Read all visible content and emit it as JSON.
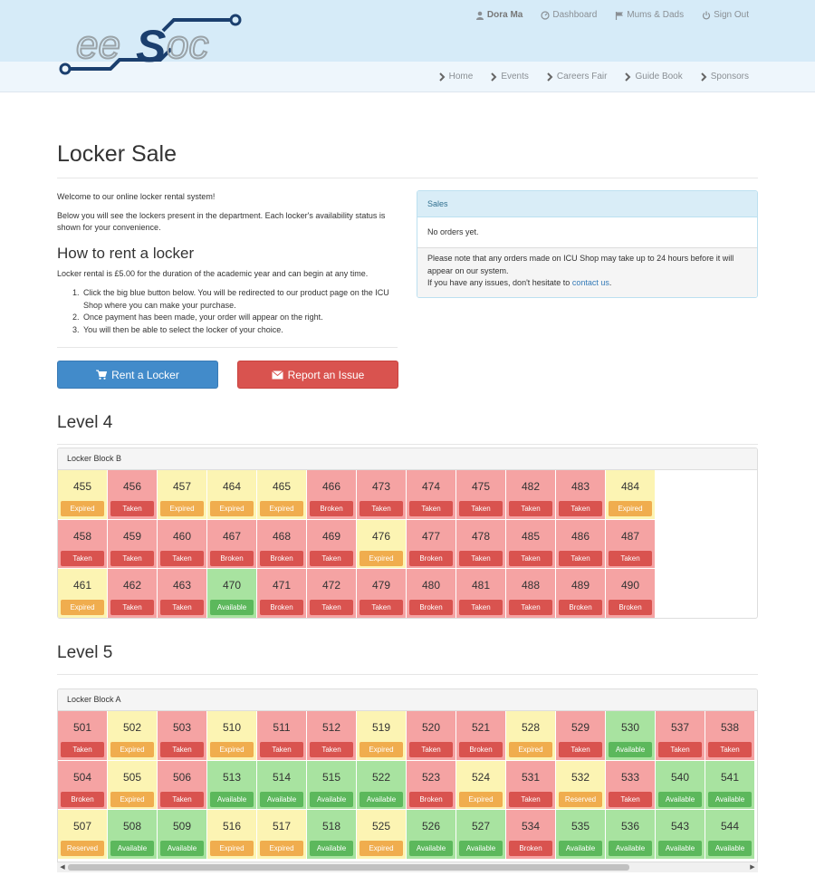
{
  "header": {
    "user": "Dora Ma",
    "top_links": [
      "Dashboard",
      "Mums & Dads",
      "Sign Out"
    ],
    "main_nav": [
      "Home",
      "Events",
      "Careers Fair",
      "Guide Book",
      "Sponsors"
    ]
  },
  "page": {
    "title": "Locker Sale",
    "welcome": "Welcome to our online locker rental system!",
    "intro": "Below you will see the lockers present in the department. Each locker's availability status is shown for your convenience.",
    "howto_title": "How to rent a locker",
    "price_text": "Locker rental is £5.00 for the duration of the academic year and can begin at any time.",
    "steps": [
      "Click the big blue button below. You will be redirected to our product page on the ICU Shop where you can make your purchase.",
      "Once payment has been made, your order will appear on the right.",
      "You will then be able to select the locker of your choice."
    ],
    "rent_button": "Rent a Locker",
    "report_button": "Report an Issue"
  },
  "sales": {
    "heading": "Sales",
    "empty": "No orders yet.",
    "note": "Please note that any orders made on ICU Shop may take up to 24 hours before it will appear on our system.",
    "contact_prefix": "If you have any issues, don't hesitate to",
    "contact_link": "contact us",
    "contact_suffix": "."
  },
  "levels": [
    {
      "title": "Level 4",
      "block": "Locker Block B",
      "rows": [
        [
          [
            "455",
            "Expired"
          ],
          [
            "456",
            "Taken"
          ],
          [
            "457",
            "Expired"
          ],
          [
            "464",
            "Expired"
          ],
          [
            "465",
            "Expired"
          ],
          [
            "466",
            "Broken"
          ],
          [
            "473",
            "Taken"
          ],
          [
            "474",
            "Taken"
          ],
          [
            "475",
            "Taken"
          ],
          [
            "482",
            "Taken"
          ],
          [
            "483",
            "Taken"
          ],
          [
            "484",
            "Expired"
          ]
        ],
        [
          [
            "458",
            "Taken"
          ],
          [
            "459",
            "Taken"
          ],
          [
            "460",
            "Taken"
          ],
          [
            "467",
            "Broken"
          ],
          [
            "468",
            "Broken"
          ],
          [
            "469",
            "Taken"
          ],
          [
            "476",
            "Expired"
          ],
          [
            "477",
            "Broken"
          ],
          [
            "478",
            "Taken"
          ],
          [
            "485",
            "Taken"
          ],
          [
            "486",
            "Taken"
          ],
          [
            "487",
            "Taken"
          ]
        ],
        [
          [
            "461",
            "Expired"
          ],
          [
            "462",
            "Taken"
          ],
          [
            "463",
            "Taken"
          ],
          [
            "470",
            "Available"
          ],
          [
            "471",
            "Broken"
          ],
          [
            "472",
            "Taken"
          ],
          [
            "479",
            "Taken"
          ],
          [
            "480",
            "Broken"
          ],
          [
            "481",
            "Taken"
          ],
          [
            "488",
            "Taken"
          ],
          [
            "489",
            "Broken"
          ],
          [
            "490",
            "Broken"
          ]
        ]
      ]
    },
    {
      "title": "Level 5",
      "block": "Locker Block A",
      "rows": [
        [
          [
            "501",
            "Taken"
          ],
          [
            "502",
            "Expired"
          ],
          [
            "503",
            "Taken"
          ],
          [
            "510",
            "Expired"
          ],
          [
            "511",
            "Taken"
          ],
          [
            "512",
            "Taken"
          ],
          [
            "519",
            "Expired"
          ],
          [
            "520",
            "Taken"
          ],
          [
            "521",
            "Broken"
          ],
          [
            "528",
            "Expired"
          ],
          [
            "529",
            "Taken"
          ],
          [
            "530",
            "Available"
          ],
          [
            "537",
            "Taken"
          ],
          [
            "538",
            "Taken"
          ]
        ],
        [
          [
            "504",
            "Broken"
          ],
          [
            "505",
            "Expired"
          ],
          [
            "506",
            "Taken"
          ],
          [
            "513",
            "Available"
          ],
          [
            "514",
            "Available"
          ],
          [
            "515",
            "Available"
          ],
          [
            "522",
            "Available"
          ],
          [
            "523",
            "Broken"
          ],
          [
            "524",
            "Expired"
          ],
          [
            "531",
            "Taken"
          ],
          [
            "532",
            "Reserved"
          ],
          [
            "533",
            "Taken"
          ],
          [
            "540",
            "Available"
          ],
          [
            "541",
            "Available"
          ]
        ],
        [
          [
            "507",
            "Reserved"
          ],
          [
            "508",
            "Available"
          ],
          [
            "509",
            "Available"
          ],
          [
            "516",
            "Expired"
          ],
          [
            "517",
            "Expired"
          ],
          [
            "518",
            "Available"
          ],
          [
            "525",
            "Expired"
          ],
          [
            "526",
            "Available"
          ],
          [
            "527",
            "Available"
          ],
          [
            "534",
            "Broken"
          ],
          [
            "535",
            "Available"
          ],
          [
            "536",
            "Available"
          ],
          [
            "543",
            "Available"
          ],
          [
            "544",
            "Available"
          ]
        ]
      ]
    }
  ],
  "colors": {
    "header_bg": "#d6ebf8",
    "nav_bg": "#eef6fc",
    "primary": "#428bca",
    "danger": "#d9534f",
    "warning": "#f0ad4e",
    "success": "#5cb85c"
  }
}
